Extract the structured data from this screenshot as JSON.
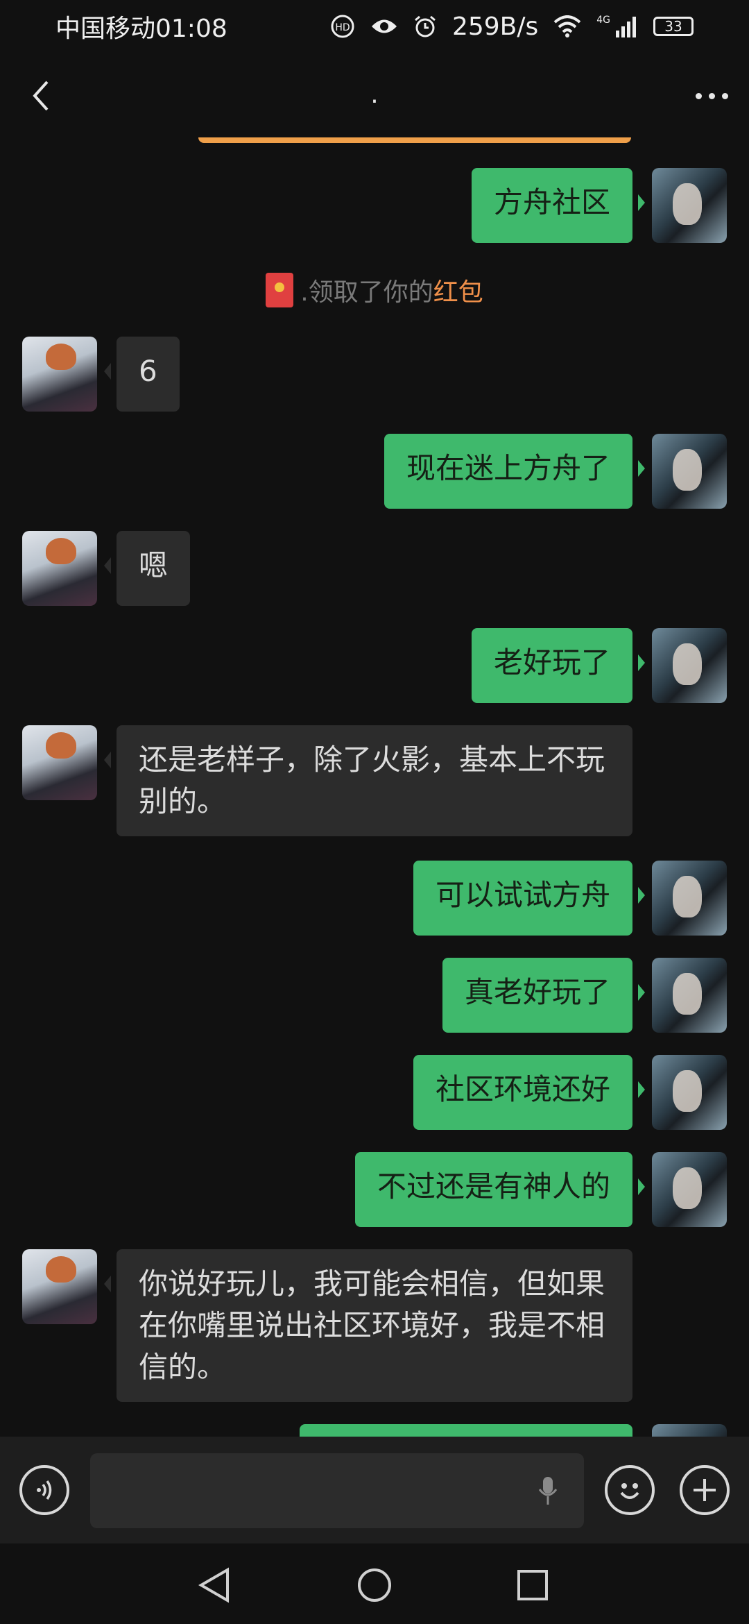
{
  "status_bar": {
    "carrier_time": "中国移动01:08",
    "net_speed": "259B/s",
    "network": "4G",
    "battery": "33"
  },
  "header": {
    "back_icon": "chevron-left-icon",
    "title": ".",
    "more_icon": "more-dots-icon"
  },
  "messages": [
    {
      "from": "me",
      "text": "方舟社区"
    },
    {
      "type": "system",
      "prefix": ".领取了你的",
      "highlight": "红包"
    },
    {
      "from": "other",
      "text": "6"
    },
    {
      "from": "me",
      "text": "现在迷上方舟了"
    },
    {
      "from": "other",
      "text": "嗯"
    },
    {
      "from": "me",
      "text": "老好玩了"
    },
    {
      "from": "other",
      "text": "还是老样子，除了火影，基本上不玩别的。"
    },
    {
      "from": "me",
      "text": "可以试试方舟"
    },
    {
      "from": "me",
      "text": "真老好玩了"
    },
    {
      "from": "me",
      "text": "社区环境还好"
    },
    {
      "from": "me",
      "text": "不过还是有神人的"
    },
    {
      "from": "other",
      "text": "你说好玩儿，我可能会相信，但如果在你嘴里说出社区环境好，我是不相信的。"
    },
    {
      "from": "me",
      "text": ""
    }
  ],
  "input_bar": {
    "voice_icon": "voice-icon",
    "placeholder": "",
    "mic_icon": "microphone-icon",
    "emoji_icon": "emoji-icon",
    "plus_icon": "plus-icon"
  },
  "system_nav": [
    "back-triangle-icon",
    "home-circle-icon",
    "recents-square-icon"
  ],
  "colors": {
    "background": "#111111",
    "my_bubble": "#3fb96c",
    "other_bubble": "#2c2c2c",
    "highlight": "#f0904a"
  }
}
